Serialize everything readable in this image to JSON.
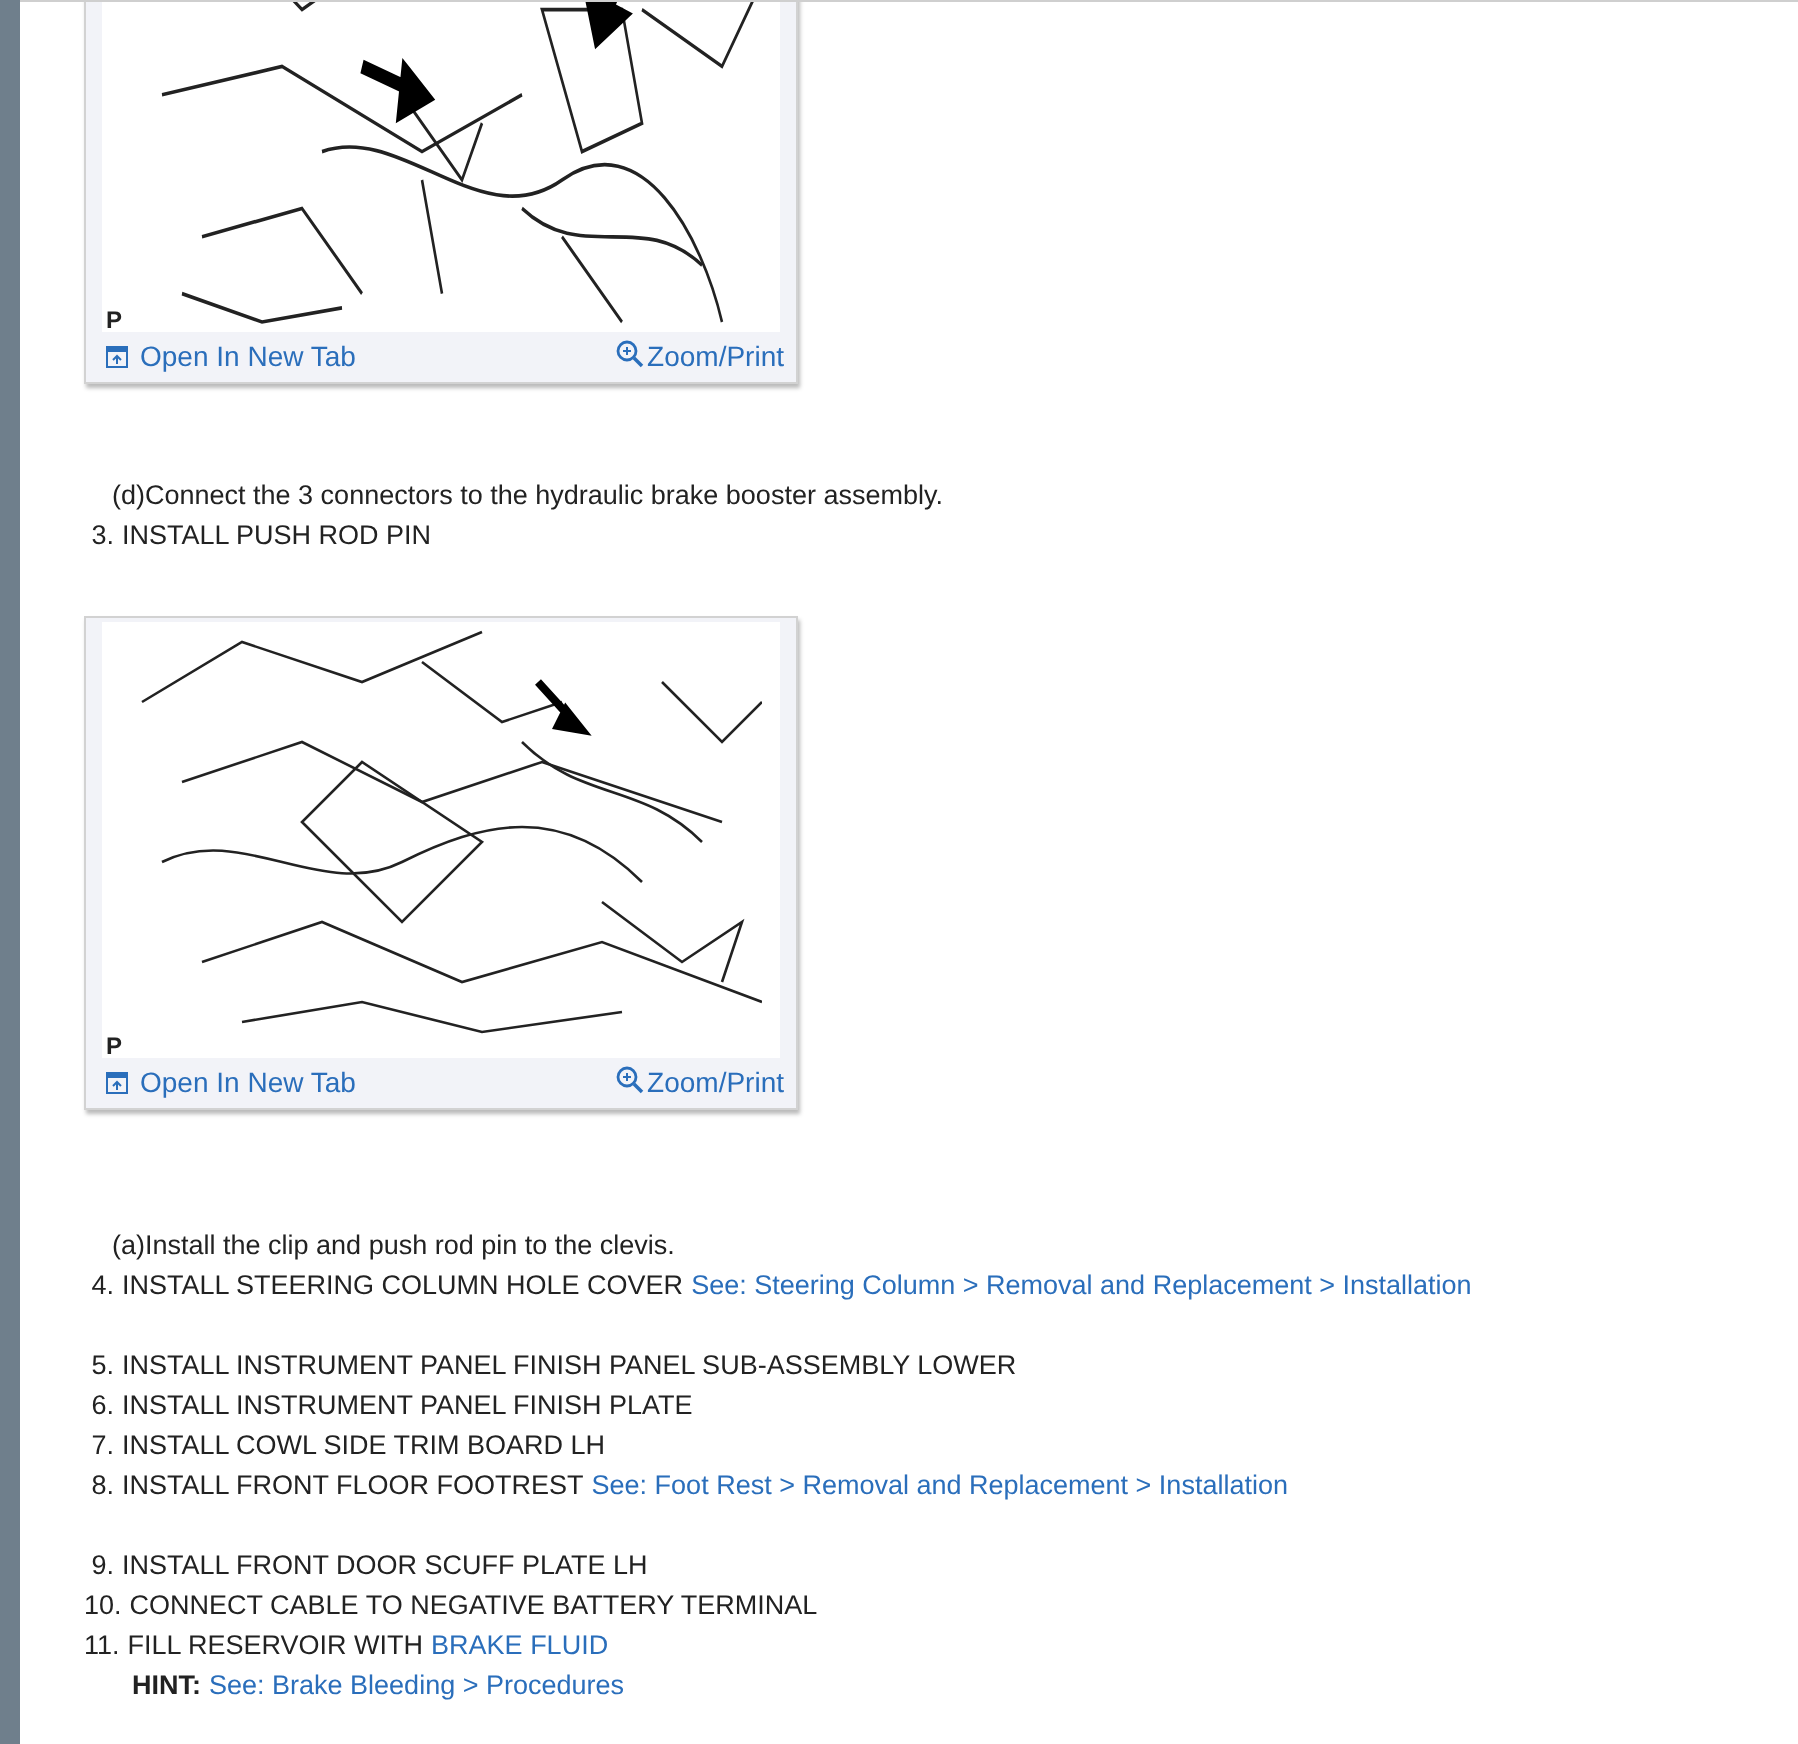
{
  "blocks": [
    {
      "kind": "figure",
      "label": "P",
      "open_link": "Open In New Tab",
      "zoom_link": "Zoom/Print"
    },
    {
      "kind": "substep",
      "text": "(d)Connect the 3 connectors to the hydraulic brake booster assembly."
    },
    {
      "kind": "step",
      "number": "3.",
      "text": "INSTALL PUSH ROD PIN"
    },
    {
      "kind": "figure",
      "label": "P",
      "open_link": "Open In New Tab",
      "zoom_link": "Zoom/Print"
    },
    {
      "kind": "substep",
      "text": "(a)Install the clip and push rod pin to the clevis."
    },
    {
      "kind": "group",
      "items": [
        {
          "kind": "step",
          "number": "4.",
          "text": "INSTALL STEERING COLUMN HOLE COVER",
          "link": "See: Steering Column > Removal and Replacement > Installation"
        }
      ]
    },
    {
      "kind": "group",
      "items": [
        {
          "kind": "step",
          "number": "5.",
          "text": "INSTALL INSTRUMENT PANEL FINISH PANEL SUB-ASSEMBLY LOWER"
        },
        {
          "kind": "step",
          "number": "6.",
          "text": "INSTALL INSTRUMENT PANEL FINISH PLATE"
        },
        {
          "kind": "step",
          "number": "7.",
          "text": "INSTALL COWL SIDE TRIM BOARD LH"
        },
        {
          "kind": "step",
          "number": "8.",
          "text": "INSTALL FRONT FLOOR FOOTREST",
          "link": "See: Foot Rest > Removal and Replacement > Installation"
        }
      ]
    },
    {
      "kind": "group",
      "items": [
        {
          "kind": "step",
          "number": "9.",
          "text": "INSTALL FRONT DOOR SCUFF PLATE LH"
        },
        {
          "kind": "step",
          "number": "10.",
          "text": "CONNECT CABLE TO NEGATIVE BATTERY TERMINAL"
        },
        {
          "kind": "step",
          "number": "11.",
          "text": "FILL RESERVOIR WITH",
          "link": "BRAKE FLUID"
        },
        {
          "kind": "hint",
          "label": "HINT:",
          "link": "See: Brake Bleeding > Procedures"
        }
      ]
    }
  ]
}
